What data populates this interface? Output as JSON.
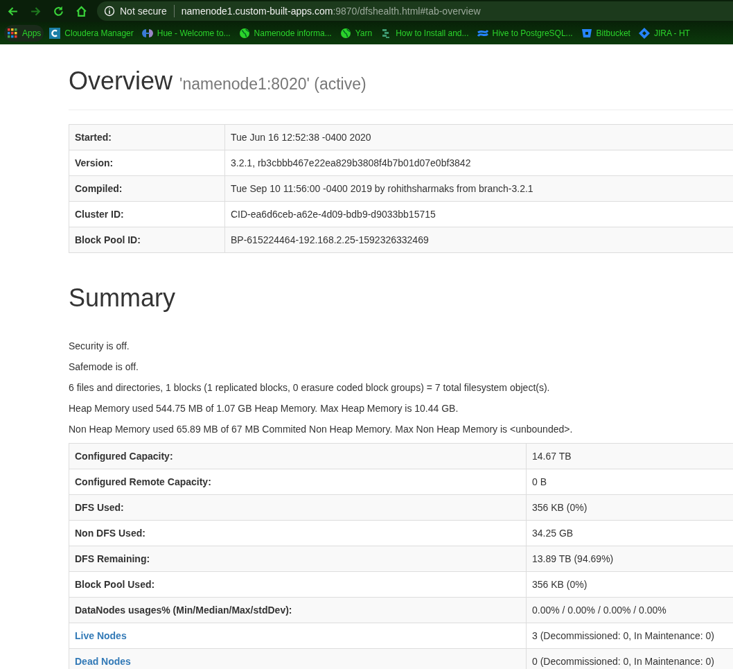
{
  "browser": {
    "security": "Not secure",
    "url_host": "namenode1.custom-built-apps.com",
    "url_rest": ":9870/dfshealth.html#tab-overview",
    "bookmarks": [
      {
        "kind": "apps",
        "label": "Apps"
      },
      {
        "kind": "cloudera",
        "label": "Cloudera Manager"
      },
      {
        "kind": "hue",
        "label": "Hue - Welcome to..."
      },
      {
        "kind": "globe",
        "label": "Namenode informa..."
      },
      {
        "kind": "globe",
        "label": "Yarn"
      },
      {
        "kind": "stack",
        "label": "How to Install and..."
      },
      {
        "kind": "confluence",
        "label": "Hive to PostgreSQL..."
      },
      {
        "kind": "bitbucket",
        "label": "Bitbucket"
      },
      {
        "kind": "jira",
        "label": "JIRA - HT"
      }
    ]
  },
  "overview": {
    "title": "Overview",
    "subtitle": "'namenode1:8020' (active)",
    "rows": [
      {
        "label": "Started:",
        "value": "Tue Jun 16 12:52:38 -0400 2020"
      },
      {
        "label": "Version:",
        "value": "3.2.1, rb3cbbb467e22ea829b3808f4b7b01d07e0bf3842"
      },
      {
        "label": "Compiled:",
        "value": "Tue Sep 10 11:56:00 -0400 2019 by rohithsharmaks from branch-3.2.1"
      },
      {
        "label": "Cluster ID:",
        "value": "CID-ea6d6ceb-a62e-4d09-bdb9-d9033bb15715"
      },
      {
        "label": "Block Pool ID:",
        "value": "BP-615224464-192.168.2.25-1592326332469"
      }
    ]
  },
  "summary": {
    "title": "Summary",
    "lines": [
      "Security is off.",
      "Safemode is off.",
      "6 files and directories, 1 blocks (1 replicated blocks, 0 erasure coded block groups) = 7 total filesystem object(s).",
      "Heap Memory used 544.75 MB of 1.07 GB Heap Memory. Max Heap Memory is 10.44 GB.",
      "Non Heap Memory used 65.89 MB of 67 MB Commited Non Heap Memory. Max Non Heap Memory is <unbounded>."
    ],
    "rows": [
      {
        "kind": "text",
        "label": "Configured Capacity:",
        "value": "14.67 TB"
      },
      {
        "kind": "text",
        "label": "Configured Remote Capacity:",
        "value": "0 B"
      },
      {
        "kind": "text",
        "label": "DFS Used:",
        "value": "356 KB (0%)"
      },
      {
        "kind": "text",
        "label": "Non DFS Used:",
        "value": "34.25 GB"
      },
      {
        "kind": "text",
        "label": "DFS Remaining:",
        "value": "13.89 TB (94.69%)"
      },
      {
        "kind": "text",
        "label": "Block Pool Used:",
        "value": "356 KB (0%)"
      },
      {
        "kind": "text",
        "label": "DataNodes usages% (Min/Median/Max/stdDev):",
        "value": "0.00% / 0.00% / 0.00% / 0.00%"
      },
      {
        "kind": "link",
        "label": "Live Nodes",
        "value": "3 (Decommissioned: 0, In Maintenance: 0)"
      },
      {
        "kind": "link",
        "label": "Dead Nodes",
        "value": "0 (Decommissioned: 0, In Maintenance: 0)"
      }
    ]
  }
}
